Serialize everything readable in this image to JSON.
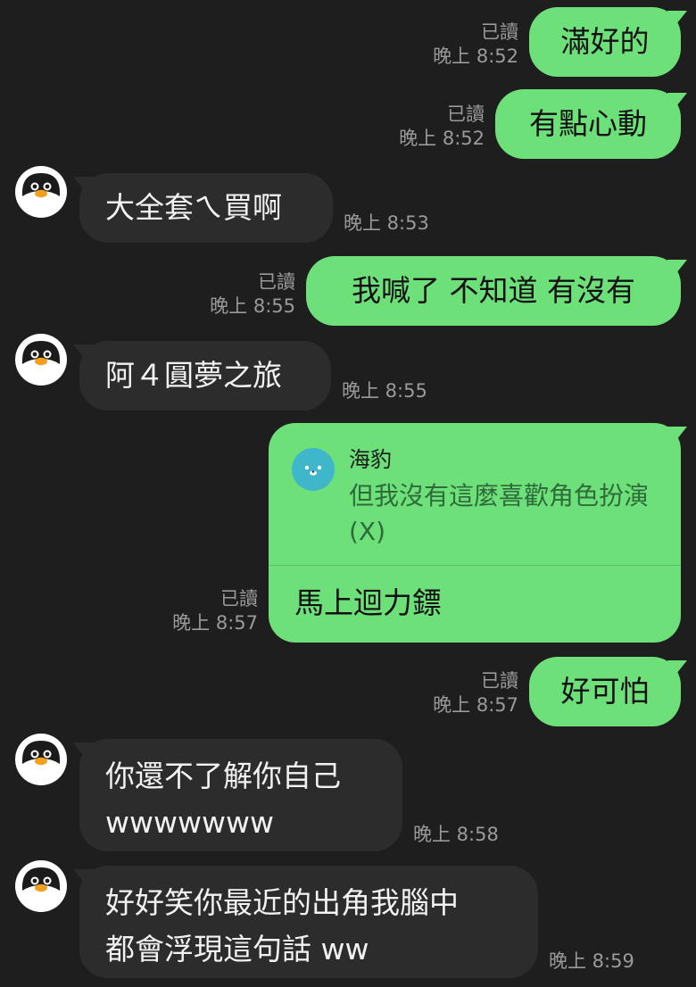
{
  "colors": {
    "background": "#1e1e1e",
    "outgoing_bubble": "#6de07a",
    "incoming_bubble": "#2c2c2c",
    "meta_text": "#9a9a9a"
  },
  "messages": [
    {
      "direction": "out",
      "text": "滿好的",
      "read": "已讀",
      "time": "晚上 8:52"
    },
    {
      "direction": "out",
      "text": "有點心動",
      "read": "已讀",
      "time": "晚上 8:52"
    },
    {
      "direction": "in",
      "avatar": "penguin-avatar-icon",
      "text": "大全套ㄟ買啊",
      "time": "晚上 8:53"
    },
    {
      "direction": "out",
      "text": "我喊了 不知道 有沒有",
      "read": "已讀",
      "time": "晚上 8:55"
    },
    {
      "direction": "in",
      "avatar": "penguin-avatar-icon",
      "text": "阿４圓夢之旅",
      "time": "晚上 8:55"
    },
    {
      "direction": "out",
      "type": "reply",
      "quoted_name": "海豹",
      "quoted_text": "但我沒有這麼喜歡角色扮演 (X)",
      "quoted_avatar": "seal-avatar-icon",
      "text": "馬上迴力鏢",
      "read": "已讀",
      "time": "晚上 8:57"
    },
    {
      "direction": "out",
      "text": "好可怕",
      "read": "已讀",
      "time": "晚上 8:57"
    },
    {
      "direction": "in",
      "avatar": "penguin-avatar-icon",
      "lines": [
        "你還不了解你自己",
        "wwwwwww"
      ],
      "time": "晚上 8:58"
    },
    {
      "direction": "in",
      "avatar": "penguin-avatar-icon",
      "lines": [
        "好好笑你最近的出角我腦中",
        "都會浮現這句話 ww"
      ],
      "time": "晚上 8:59"
    }
  ]
}
